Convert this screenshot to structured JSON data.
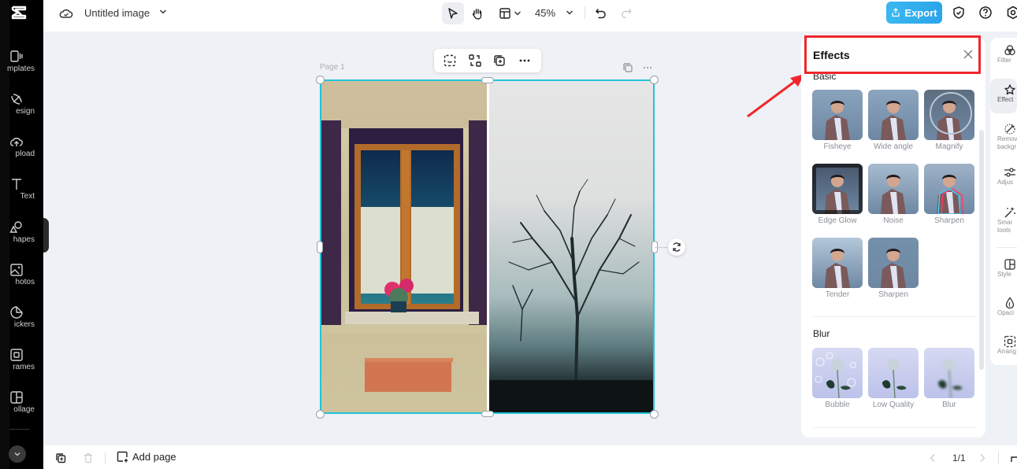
{
  "app": {
    "logo": "capcut-logo-icon"
  },
  "left_rail": {
    "items": [
      {
        "label": "Templates",
        "visible_label": "mplates",
        "icon": "templates-icon"
      },
      {
        "label": "Design",
        "visible_label": "esign",
        "icon": "design-icon"
      },
      {
        "label": "Upload",
        "visible_label": "pload",
        "icon": "upload-icon"
      },
      {
        "label": "Text",
        "visible_label": "Text",
        "icon": "text-icon"
      },
      {
        "label": "Shapes",
        "visible_label": "hapes",
        "icon": "shapes-icon"
      },
      {
        "label": "Photos",
        "visible_label": "hotos",
        "icon": "photos-icon"
      },
      {
        "label": "Stickers",
        "visible_label": "ickers",
        "icon": "stickers-icon"
      },
      {
        "label": "Frames",
        "visible_label": "rames",
        "icon": "frames-icon"
      },
      {
        "label": "Collage",
        "visible_label": "ollage",
        "icon": "collage-icon"
      }
    ],
    "more_icon": "chevron-down-icon"
  },
  "topbar": {
    "title": "Untitled image",
    "zoom": "45%",
    "export_label": "Export",
    "tools": [
      "select-tool",
      "hand-tool",
      "layout-tool",
      "undo",
      "redo"
    ]
  },
  "canvas": {
    "page_label": "Page 1",
    "floating_toolbar": [
      "smart-crop",
      "replace",
      "duplicate",
      "more"
    ],
    "images": [
      {
        "name": "window-with-flowers",
        "desc": "Rustic window with curtains and flower pot"
      },
      {
        "name": "foggy-tree",
        "desc": "Bare tree silhouette in fog"
      }
    ]
  },
  "effects_panel": {
    "title": "Effects",
    "sections": [
      {
        "title": "Basic",
        "items": [
          "Fisheye",
          "Wide angle",
          "Magnify",
          "Edge Glow",
          "Noise",
          "Sharpen",
          "Tender",
          "Sharpen"
        ]
      },
      {
        "title": "Blur",
        "items": [
          "Bubble",
          "Low Quality",
          "Blur"
        ]
      }
    ]
  },
  "right_rail": {
    "items": [
      {
        "label": "Filters",
        "visible_label": "Filter",
        "icon": "filters-icon"
      },
      {
        "label": "Effects",
        "visible_label": "Effect",
        "icon": "effects-icon",
        "active": true
      },
      {
        "label": "Remove background",
        "visible_label": "Remov backgr",
        "icon": "remove-background-icon"
      },
      {
        "label": "Adjust",
        "visible_label": "Adjus",
        "icon": "adjust-icon"
      },
      {
        "label": "Smart tools",
        "visible_label": "Smar tools",
        "icon": "smart-tools-icon"
      },
      {
        "label": "Style",
        "visible_label": "Style",
        "icon": "style-icon"
      },
      {
        "label": "Opacity",
        "visible_label": "Opaci",
        "icon": "opacity-icon"
      },
      {
        "label": "Arrange",
        "visible_label": "Arrang",
        "icon": "arrange-icon"
      }
    ]
  },
  "bottombar": {
    "add_page": "Add page",
    "pager": "1/1"
  },
  "annotation": {
    "color": "#f0262b",
    "target": "Effects panel header"
  },
  "colors": {
    "accent": "#2aa5ea",
    "selection": "#22c4d9",
    "annotation": "#f0262b"
  }
}
